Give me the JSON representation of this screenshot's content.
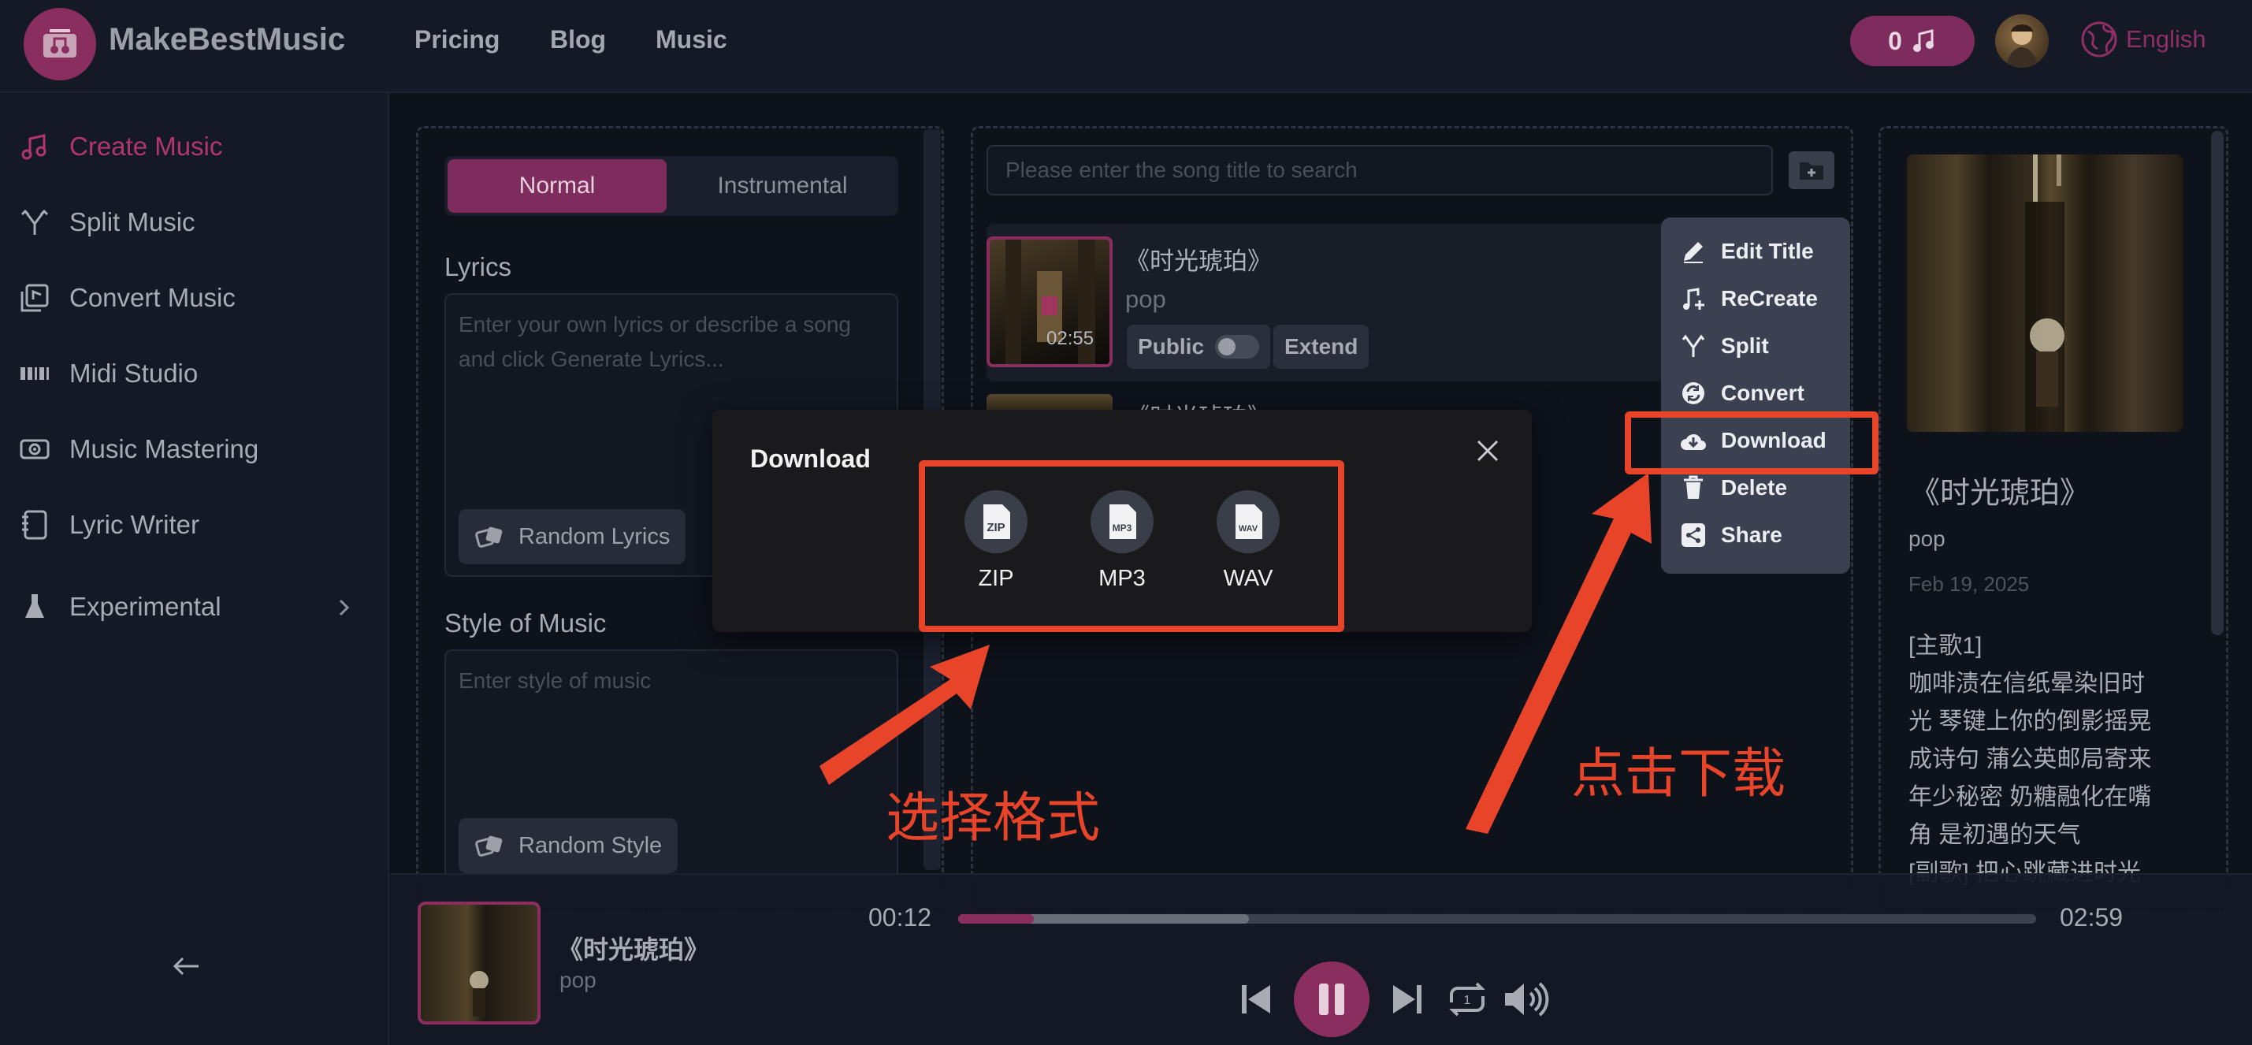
{
  "header": {
    "brand": "MakeBestMusic",
    "nav": [
      "Pricing",
      "Blog",
      "Music"
    ],
    "credits": "0",
    "language": "English"
  },
  "sidebar": {
    "items": [
      "Create Music",
      "Split Music",
      "Convert Music",
      "Midi Studio",
      "Music Mastering",
      "Lyric Writer",
      "Experimental"
    ],
    "collapse_icon": "arrow-left-icon"
  },
  "create": {
    "tabs": [
      "Normal",
      "Instrumental"
    ],
    "lyrics_label": "Lyrics",
    "lyrics_placeholder": "Enter your own lyrics or describe a song and click Generate Lyrics...",
    "random_lyrics": "Random Lyrics",
    "style_label": "Style of Music",
    "style_placeholder": "Enter style of music",
    "random_style": "Random Style"
  },
  "library": {
    "search_placeholder": "Please enter the song title to search",
    "song": {
      "title": "《时光琥珀》",
      "genre": "pop",
      "duration": "02:55",
      "public_label": "Public",
      "extend_label": "Extend"
    },
    "song2_title": "《时光琥珀》"
  },
  "context_menu": [
    "Edit Title",
    "ReCreate",
    "Split",
    "Convert",
    "Download",
    "Delete",
    "Share"
  ],
  "detail": {
    "title": "《时光琥珀》",
    "genre": "pop",
    "date": "Feb 19, 2025",
    "lyrics": [
      "[主歌1]",
      "咖啡渍在信纸晕染旧时",
      "光 琴键上你的倒影摇晃",
      "成诗句 蒲公英邮局寄来",
      "年少秘密 奶糖融化在嘴",
      "角 是初遇的天气",
      "[副歌] 把心跳藏进时光"
    ]
  },
  "player": {
    "title": "《时光琥珀》",
    "genre": "pop",
    "current": "00:12",
    "total": "02:59",
    "progress": 0.07,
    "buffered": 0.27
  },
  "dialog": {
    "title": "Download",
    "formats": [
      "ZIP",
      "MP3",
      "WAV"
    ]
  },
  "annotations": {
    "choose_format": "选择格式",
    "click_download": "点击下载"
  },
  "colors": {
    "accent": "#8a2e5f",
    "annotation": "#e8442a",
    "background": "#0e121b"
  }
}
